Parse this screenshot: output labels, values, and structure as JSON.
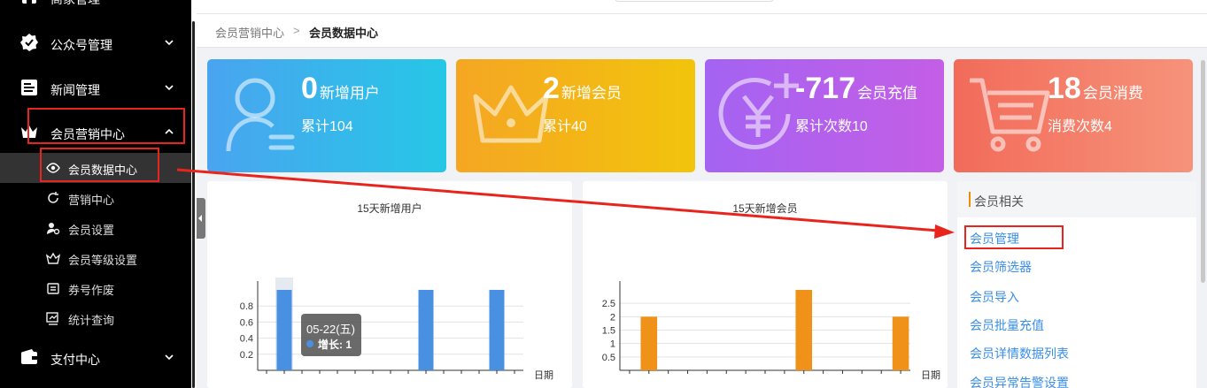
{
  "sidebar": {
    "top_partial": {
      "label": "商家管理"
    },
    "items": [
      {
        "label": "公众号管理",
        "icon": "badge-check-icon"
      },
      {
        "label": "新闻管理",
        "icon": "news-icon"
      },
      {
        "label": "会员营销中心",
        "icon": "crown-icon"
      }
    ],
    "subitems": [
      {
        "label": "会员数据中心",
        "icon": "eye-icon"
      },
      {
        "label": "营销中心",
        "icon": "refresh-icon"
      },
      {
        "label": "会员设置",
        "icon": "user-settings-icon"
      },
      {
        "label": "会员等级设置",
        "icon": "level-icon"
      },
      {
        "label": "券号作废",
        "icon": "coupon-icon"
      },
      {
        "label": "统计查询",
        "icon": "statistics-icon"
      }
    ],
    "bottom": {
      "label": "支付中心",
      "icon": "wallet-icon"
    }
  },
  "breadcrumb": {
    "parent": "会员营销中心",
    "separator": ">",
    "current": "会员数据中心"
  },
  "cards": [
    {
      "value": "0",
      "label": "新增用户",
      "sub": "累计104",
      "icon": "user-icon"
    },
    {
      "value": "2",
      "label": "新增会员",
      "sub": "累计40",
      "icon": "crown-icon"
    },
    {
      "value": "-717",
      "label": "会员充值",
      "sub": "累计次数10",
      "icon": "yuan-plus-icon"
    },
    {
      "value": "18",
      "label": "会员消费",
      "sub": "消费次数4",
      "icon": "cart-icon"
    }
  ],
  "chart_data": [
    {
      "type": "bar",
      "title": "15天新增用户",
      "xlabel": "日期",
      "ylabel": "",
      "y_ticks": [
        "0.2",
        "0.4",
        "0.6",
        "0.8"
      ],
      "ylim": [
        0,
        1
      ],
      "bar_count": 15,
      "values": [
        0,
        1,
        0,
        0,
        0,
        0,
        0,
        0,
        0,
        1,
        0,
        0,
        0,
        1,
        0
      ],
      "highlight_index": 1,
      "color": "#4a90e2",
      "tooltip": {
        "date": "05-22(五)",
        "series": "增长",
        "value": "1"
      }
    },
    {
      "type": "bar",
      "title": "15天新增会员",
      "xlabel": "日期",
      "ylabel": "",
      "y_ticks": [
        "0.5",
        "1",
        "1.5",
        "2",
        "2.5"
      ],
      "ylim": [
        0,
        3
      ],
      "bar_count": 15,
      "values": [
        0,
        2,
        0,
        0,
        0,
        0,
        0,
        0,
        0,
        3,
        0,
        0,
        0,
        0,
        2
      ],
      "color": "#f0921a"
    }
  ],
  "links": {
    "title": "会员相关",
    "items": [
      "会员管理",
      "会员筛选器",
      "会员导入",
      "会员批量充值",
      "会员详情数据列表",
      "会员异常告警设置"
    ]
  },
  "annotation_color": "#e8241c"
}
